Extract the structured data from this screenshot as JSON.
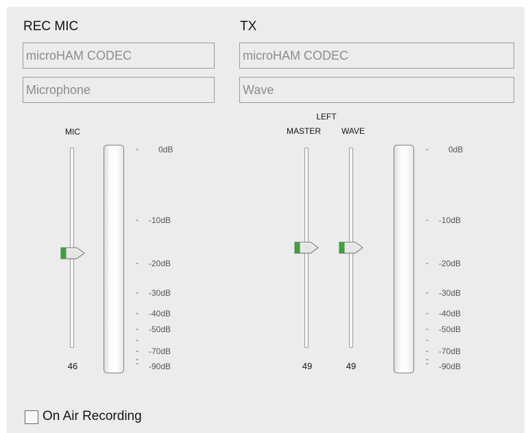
{
  "rec_mic": {
    "title": "REC MIC",
    "device": "microHAM CODEC",
    "line": "Microphone",
    "slider_label": "MIC",
    "slider_value": "46"
  },
  "tx": {
    "title": "TX",
    "device": "microHAM CODEC",
    "line": "Wave",
    "group_label_line1": "LEFT",
    "master_label": "MASTER",
    "wave_label": "WAVE",
    "master_value": "49",
    "wave_value": "49"
  },
  "scale": {
    "labels": [
      "0dB",
      "-10dB",
      "-20dB",
      "-30dB",
      "-40dB",
      "-50dB",
      "-70dB",
      "-90dB"
    ]
  },
  "on_air": {
    "label": "On Air Recording",
    "checked": false
  },
  "colors": {
    "background": "#ececec",
    "thumb_accent": "#3aa43a",
    "text_muted": "#8c8c8c"
  }
}
